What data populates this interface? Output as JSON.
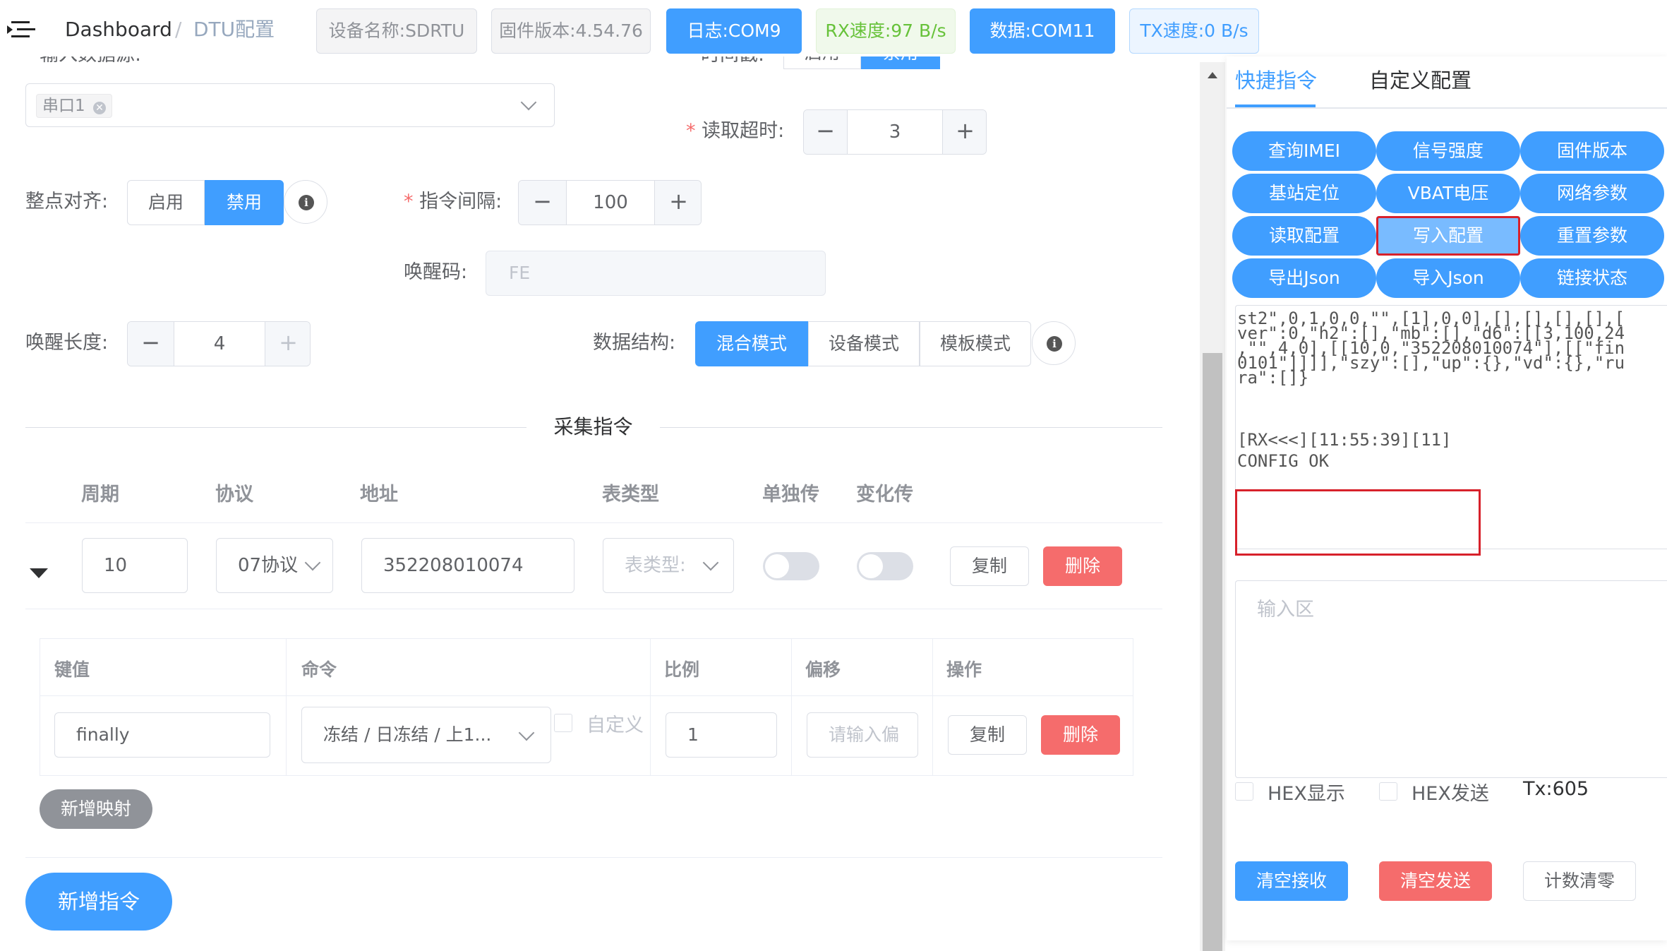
{
  "header": {
    "breadcrumb_home": "Dashboard",
    "breadcrumb_sep": "/",
    "breadcrumb_current": "DTU配置",
    "device_name": "设备名称:SDRTU",
    "firmware": "固件版本:4.54.76",
    "log_port": "日志:COM9",
    "rx_speed": "RX速度:97 B/s",
    "data_port": "数据:COM11",
    "tx_speed": "TX速度:0 B/s"
  },
  "form": {
    "input_source_label": "输入数据源:",
    "serial_tag": "串口1",
    "time_mode_label": "时间戳:",
    "time_mode_enable": "启用",
    "time_mode_disable": "禁用",
    "read_timeout_label": "读取超时:",
    "read_timeout_value": "3",
    "align_label": "整点对齐:",
    "align_enable": "启用",
    "align_disable": "禁用",
    "cmd_interval_label": "指令间隔:",
    "cmd_interval_value": "100",
    "wake_code_label": "唤醒码:",
    "wake_code_placeholder": "FE",
    "wake_len_label": "唤醒长度:",
    "wake_len_value": "4",
    "data_struct_label": "数据结构:",
    "data_struct_options": [
      "混合模式",
      "设备模式",
      "模板模式"
    ],
    "data_struct_selected": "混合模式"
  },
  "collect": {
    "divider_title": "采集指令",
    "columns": [
      "周期",
      "协议",
      "地址",
      "表类型",
      "单独传",
      "变化传"
    ],
    "row": {
      "period": "10",
      "protocol": "07协议",
      "address": "352208010074",
      "meter_type_placeholder": "表类型:",
      "copy": "复制",
      "delete": "删除"
    },
    "mapping": {
      "columns": [
        "键值",
        "命令",
        "比例",
        "偏移",
        "操作"
      ],
      "key": "finally",
      "command": "冻结 / 日冻结 / 上1...",
      "custom_label": "自定义",
      "ratio": "1",
      "offset_placeholder": "请输入偏",
      "copy": "复制",
      "delete": "删除"
    },
    "add_mapping": "新增映射",
    "add_command": "新增指令"
  },
  "panel": {
    "tabs": [
      "快捷指令",
      "自定义配置"
    ],
    "active_tab": "快捷指令",
    "quick_buttons": [
      "查询IMEI",
      "信号强度",
      "固件版本",
      "基站定位",
      "VBAT电压",
      "网络参数",
      "读取配置",
      "写入配置",
      "重置参数",
      "导出Json",
      "导入Json",
      "链接状态"
    ],
    "log_lines": [
      "st2\",0,1,0,0,\"\",[1],0,0],[],[],[],[],[",
      "ver\":0,\"h2\":[],\"mb\":[],\"d6\":[[3,100,24",
      ",\"\",4,0],[[10,0,\"352208010074\"],[[\"fin",
      "0101\"]]]],\"szy\":[],\"up\":{},\"vd\":{},\"ru",
      "ra\":[]}"
    ],
    "rx_header": "[RX<<<][11:55:39][11]",
    "rx_body": "CONFIG OK",
    "input_placeholder": "输入区",
    "hex_display": "HEX显示",
    "hex_send": "HEX发送",
    "tx_count": "Tx:605",
    "clear_receive": "清空接收",
    "clear_send": "清空发送",
    "reset_count": "计数清零"
  }
}
